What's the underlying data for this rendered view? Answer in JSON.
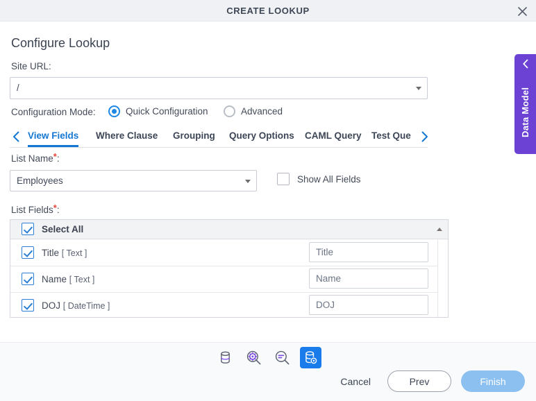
{
  "window": {
    "title": "CREATE LOOKUP",
    "close_icon": "close-icon"
  },
  "page": {
    "heading": "Configure Lookup"
  },
  "site_url": {
    "label": "Site URL:",
    "value": "/",
    "caret_icon": "chevron-down-icon"
  },
  "config_mode": {
    "label": "Configuration Mode:",
    "options": [
      {
        "label": "Quick Configuration",
        "selected": true
      },
      {
        "label": "Advanced",
        "selected": false
      }
    ]
  },
  "tabs": {
    "prev_icon": "chevron-left-icon",
    "next_icon": "chevron-right-icon",
    "items": [
      {
        "label": "View Fields",
        "active": true
      },
      {
        "label": "Where Clause",
        "active": false
      },
      {
        "label": "Grouping",
        "active": false
      },
      {
        "label": "Query Options",
        "active": false
      },
      {
        "label": "CAML Query",
        "active": false
      },
      {
        "label": "Test Que",
        "active": false
      }
    ]
  },
  "list_name": {
    "label": "List Name",
    "required_mark": "*",
    "label_suffix": ":",
    "value": "Employees",
    "caret_icon": "chevron-down-icon"
  },
  "show_all_fields": {
    "label": "Show All Fields",
    "checked": false
  },
  "list_fields": {
    "label": "List Fields",
    "required_mark": "*",
    "label_suffix": ":",
    "select_all": {
      "label": "Select All",
      "checked": true
    },
    "sort_icon": "sort-ascending-icon",
    "rows": [
      {
        "name": "Title",
        "type": "[ Text ]",
        "checked": true,
        "display_name": "Title"
      },
      {
        "name": "Name",
        "type": "[ Text ]",
        "checked": true,
        "display_name": "Name"
      },
      {
        "name": "DOJ",
        "type": "[ DateTime ]",
        "checked": true,
        "display_name": "DOJ"
      }
    ]
  },
  "toolbar": {
    "buttons": [
      {
        "icon": "database-icon",
        "active": false
      },
      {
        "icon": "database-search-settings-icon",
        "active": false
      },
      {
        "icon": "query-search-icon",
        "active": false
      },
      {
        "icon": "database-config-icon",
        "active": true
      }
    ]
  },
  "footer": {
    "cancel_label": "Cancel",
    "prev_label": "Prev",
    "finish_label": "Finish"
  },
  "side_tab": {
    "label": "Data Model",
    "chevron_icon": "chevron-left-icon"
  },
  "colors": {
    "accent_blue": "#1477d4",
    "primary_button": "#8cc0f0",
    "purple": "#6c42d4",
    "required_red": "#e8453c",
    "titlebar_bg": "#f0f1f4",
    "footer_bg": "#f9fafb",
    "active_tool_bg": "#1a7bea"
  }
}
